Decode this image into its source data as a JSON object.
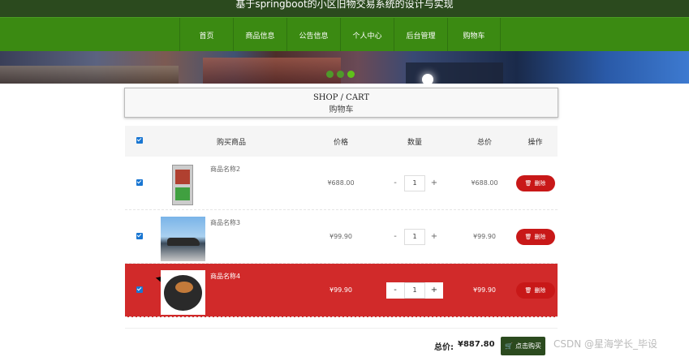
{
  "site_title": "基于springboot的小区旧物交易系统的设计与实现",
  "nav": [
    "首页",
    "商品信息",
    "公告信息",
    "个人中心",
    "后台管理",
    "购物车"
  ],
  "page_heading": {
    "en": "SHOP / CART",
    "cn": "购物车"
  },
  "table": {
    "headers": {
      "product": "购买商品",
      "price": "价格",
      "qty": "数量",
      "total": "总价",
      "op": "操作"
    },
    "rows": [
      {
        "name": "商品名称2",
        "price": "¥688.00",
        "qty": "1",
        "total": "¥688.00",
        "image": "fridge",
        "selected": false
      },
      {
        "name": "商品名称3",
        "price": "¥99.90",
        "qty": "1",
        "total": "¥99.90",
        "image": "car",
        "selected": false
      },
      {
        "name": "商品名称4",
        "price": "¥99.90",
        "qty": "1",
        "total": "¥99.90",
        "image": "pan",
        "selected": true
      }
    ],
    "delete_label": "删除",
    "minus": "-",
    "plus": "+"
  },
  "summary": {
    "label": "总价:",
    "value": "¥887.80",
    "buy_label": "点击购买"
  },
  "watermark": "CSDN @星海学长_毕设",
  "colors": {
    "nav_green": "#3b8a12",
    "topbar": "#2b4a1e",
    "selected_row": "#d12a2a",
    "delete_btn": "#c81818"
  }
}
